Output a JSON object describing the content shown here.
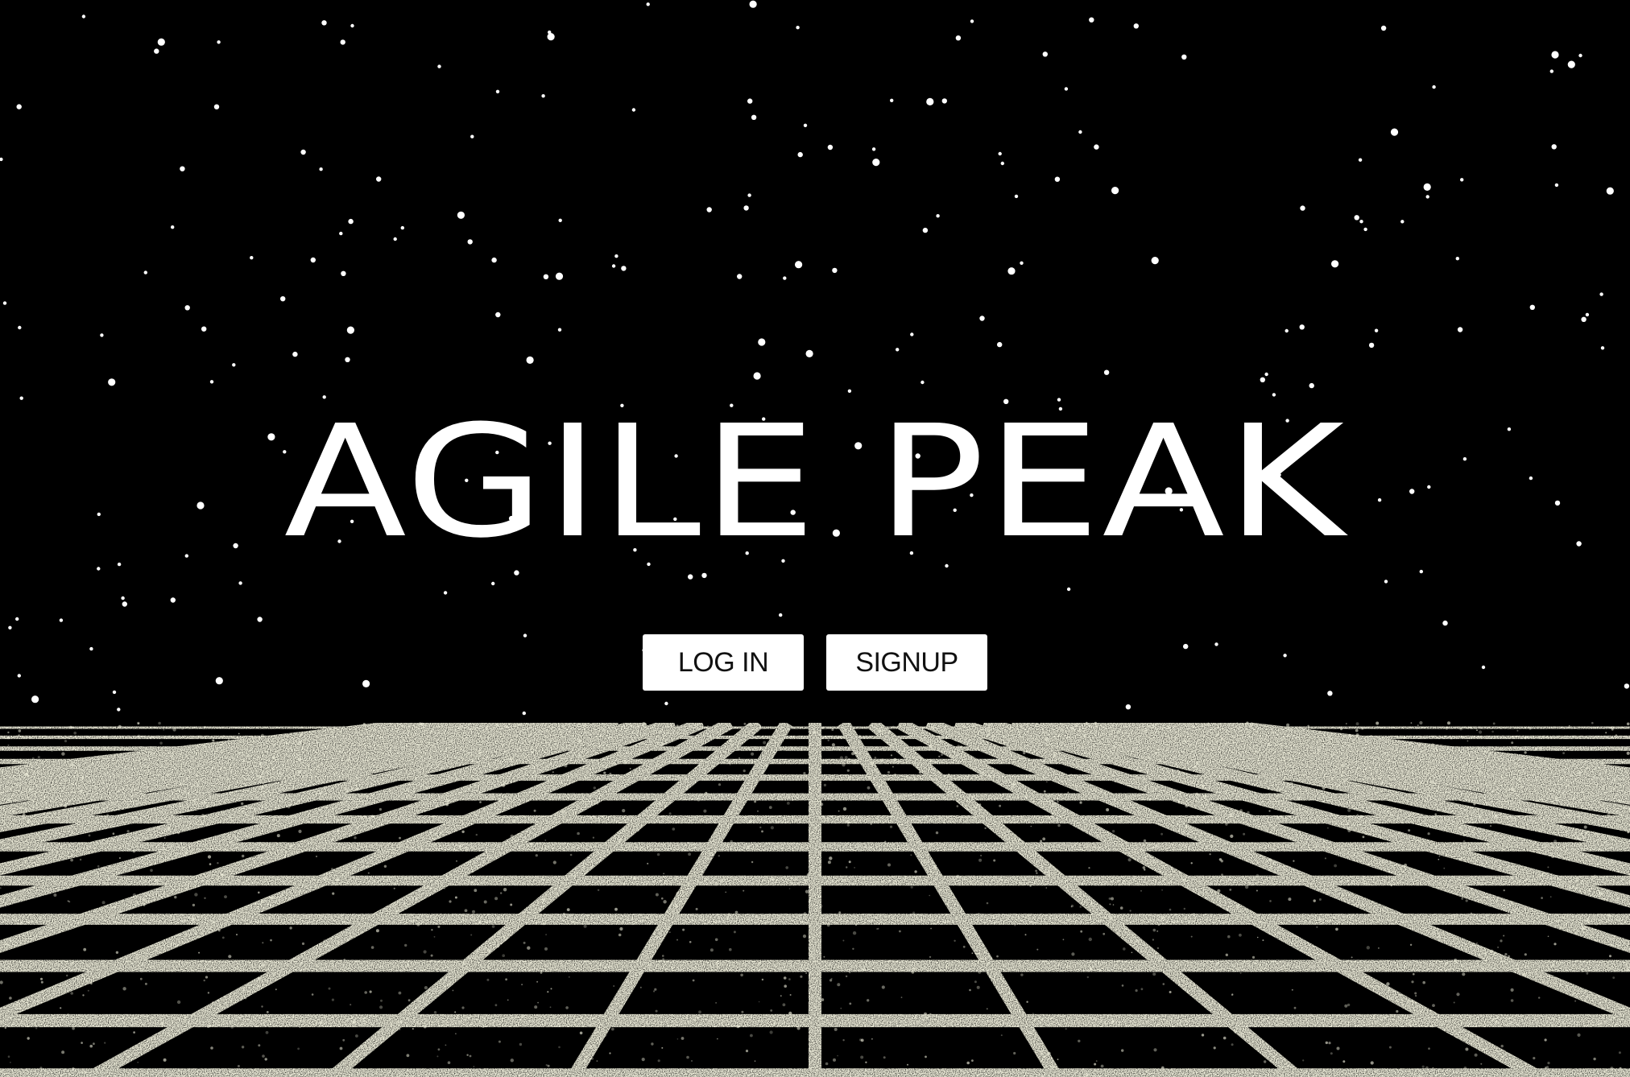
{
  "hero": {
    "title": "AGILE PEAK"
  },
  "actions": {
    "login_label": "LOG IN",
    "signup_label": "SIGNUP"
  },
  "colors": {
    "background": "#000000",
    "stars": "#ffffff",
    "grid": "#f0efdc",
    "button_bg": "#ffffff",
    "button_text": "#111111"
  }
}
